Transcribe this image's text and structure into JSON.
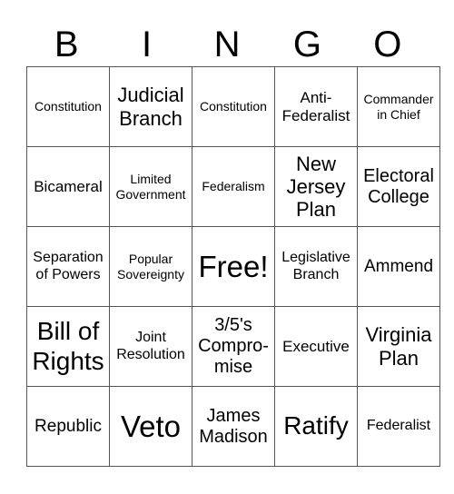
{
  "header": [
    "B",
    "I",
    "N",
    "G",
    "O"
  ],
  "rows": [
    [
      "Constitution",
      "Judicial Branch",
      "Constitution",
      "Anti-Federalist",
      "Commander in Chief"
    ],
    [
      "Bicameral",
      "Limited Government",
      "Federalism",
      "New Jersey Plan",
      "Electoral College"
    ],
    [
      "Separation of Powers",
      "Popular Sovereignty",
      "Free!",
      "Legislative Branch",
      "Ammend"
    ],
    [
      "Bill of Rights",
      "Joint Resolution",
      "3/5's Compro-mise",
      "Executive",
      "Virginia Plan"
    ],
    [
      "Republic",
      "Veto",
      "James Madison",
      "Ratify",
      "Federalist"
    ]
  ]
}
